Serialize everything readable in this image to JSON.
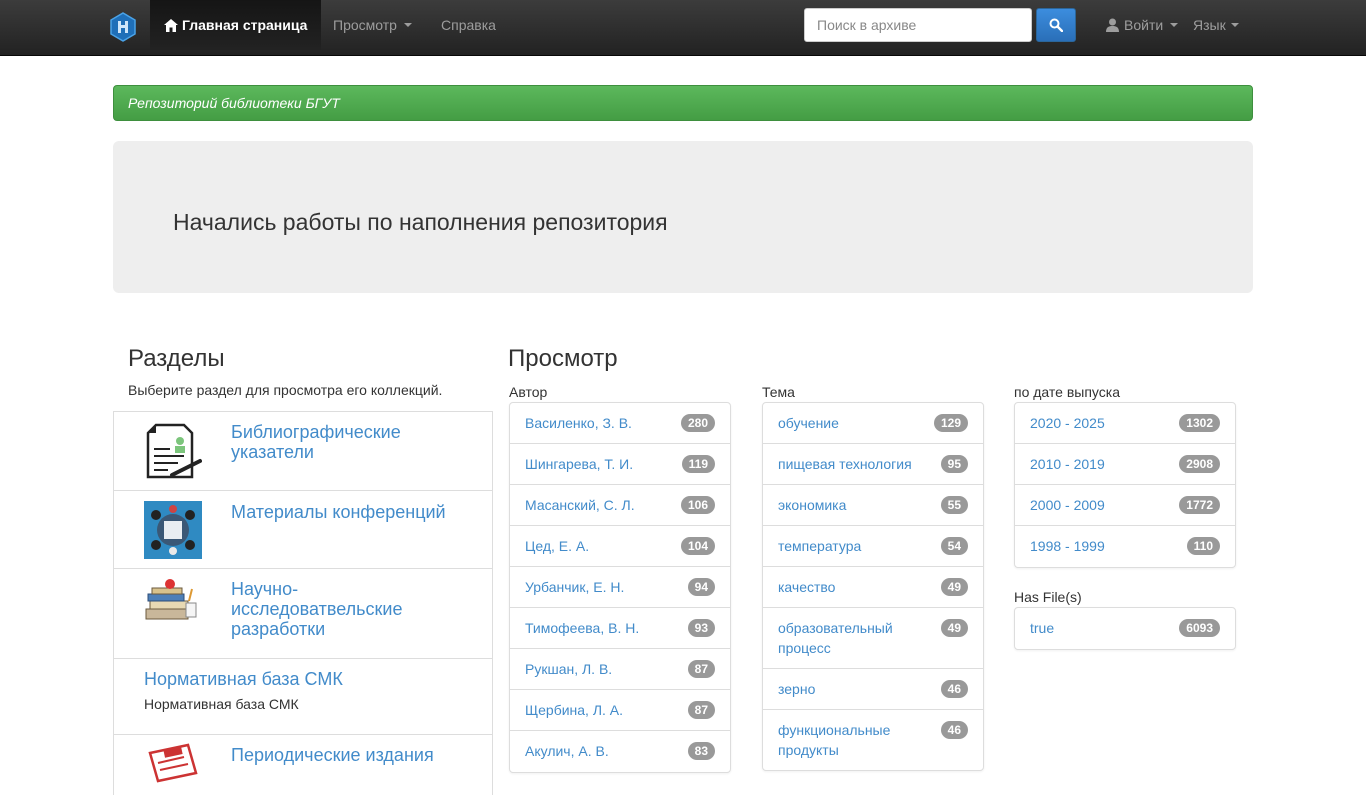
{
  "navbar": {
    "home_label": "Главная страница",
    "browse_label": "Просмотр",
    "help_label": "Справка",
    "search_placeholder": "Поиск в архиве",
    "login_label": "Войти",
    "language_label": "Язык"
  },
  "banner": {
    "text": "Репозиторий библиотеки БГУТ"
  },
  "jumbotron": {
    "text": "Начались работы по наполнения репозитория"
  },
  "sections": {
    "heading": "Разделы",
    "description": "Выберите раздел для просмотра его коллекций.",
    "items": [
      {
        "label": "Библиографические указатели",
        "icon": "document-icon"
      },
      {
        "label": "Материалы конференций",
        "icon": "conference-icon"
      },
      {
        "label": "Научно-исследоватвельские разработки",
        "icon": "books-icon"
      },
      {
        "label": "Нормативная база СМК",
        "subtitle": "Нормативная база СМК"
      },
      {
        "label": "Периодические издания",
        "icon": "newspaper-icon"
      }
    ]
  },
  "browse": {
    "heading": "Просмотр",
    "author": {
      "label": "Автор",
      "items": [
        {
          "name": "Василенко, З. В.",
          "count": "280"
        },
        {
          "name": "Шингарева, Т. И.",
          "count": "119"
        },
        {
          "name": "Масанский, С. Л.",
          "count": "106"
        },
        {
          "name": "Цед, Е. А.",
          "count": "104"
        },
        {
          "name": "Урбанчик, Е. Н.",
          "count": "94"
        },
        {
          "name": "Тимофеева, В. Н.",
          "count": "93"
        },
        {
          "name": "Рукшан, Л. В.",
          "count": "87"
        },
        {
          "name": "Щербина, Л. А.",
          "count": "87"
        },
        {
          "name": "Акулич, А. В.",
          "count": "83"
        }
      ]
    },
    "subject": {
      "label": "Тема",
      "items": [
        {
          "name": "обучение",
          "count": "129"
        },
        {
          "name": "пищевая технология",
          "count": "95"
        },
        {
          "name": "экономика",
          "count": "55"
        },
        {
          "name": "температура",
          "count": "54"
        },
        {
          "name": "качество",
          "count": "49"
        },
        {
          "name": "образовательный процесс",
          "count": "49"
        },
        {
          "name": "зерно",
          "count": "46"
        },
        {
          "name": "функциональные продукты",
          "count": "46"
        }
      ]
    },
    "date": {
      "label": "по дате выпуска",
      "items": [
        {
          "name": "2020 - 2025",
          "count": "1302"
        },
        {
          "name": "2010 - 2019",
          "count": "2908"
        },
        {
          "name": "2000 - 2009",
          "count": "1772"
        },
        {
          "name": "1998 - 1999",
          "count": "110"
        }
      ]
    },
    "hasfile": {
      "label": "Has File(s)",
      "items": [
        {
          "name": "true",
          "count": "6093"
        }
      ]
    }
  }
}
